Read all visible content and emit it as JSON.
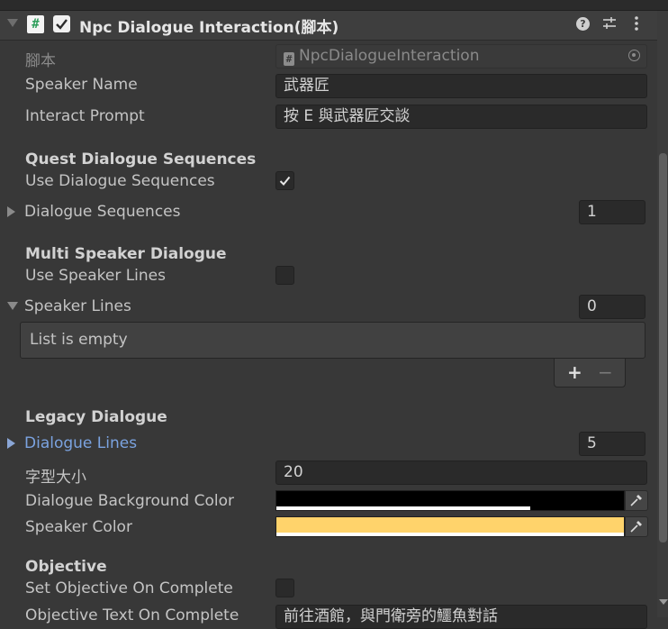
{
  "header": {
    "title": "Npc Dialogue Interaction(腳本)",
    "script_icon_glyph": "#",
    "help_glyph": "?",
    "enabled": true
  },
  "fields": {
    "script": {
      "label": "腳本",
      "value": "NpcDialogueInteraction",
      "icon_glyph": "#"
    },
    "speaker_name": {
      "label": "Speaker Name",
      "value": "武器匠"
    },
    "interact_prompt": {
      "label": "Interact Prompt",
      "value": "按 E 與武器匠交談"
    }
  },
  "quest_section": {
    "header": "Quest Dialogue Sequences",
    "use_label": "Use Dialogue Sequences",
    "use_checked": true,
    "list_label": "Dialogue Sequences",
    "list_count": "1"
  },
  "multi_section": {
    "header": "Multi Speaker Dialogue",
    "use_label": "Use Speaker Lines",
    "use_checked": false,
    "list_label": "Speaker Lines",
    "list_count": "0",
    "empty_text": "List is empty",
    "add_glyph": "+",
    "remove_glyph": "−"
  },
  "legacy_section": {
    "header": "Legacy Dialogue",
    "lines_label": "Dialogue Lines",
    "lines_count": "5",
    "font_size_label": "字型大小",
    "font_size_value": "20",
    "bg_color_label": "Dialogue Background Color",
    "bg_color": "#000000",
    "bg_alpha": 0.73,
    "speaker_color_label": "Speaker Color",
    "speaker_color": "#ffd36b",
    "speaker_alpha": 1.0
  },
  "objective_section": {
    "header": "Objective",
    "set_label": "Set Objective On Complete",
    "set_checked": false,
    "text_label": "Objective Text On Complete",
    "text_value": "前往酒館，與門衛旁的鱷魚對話"
  },
  "colors": {
    "panel_bg": "#383838",
    "link": "#7ba3e0",
    "check_green": "#2e9e5b"
  },
  "icons": [
    "fold-arrow-icon",
    "script-icon",
    "checkbox-icon",
    "help-icon",
    "presets-icon",
    "kebab-menu-icon",
    "object-picker-icon",
    "eyedropper-icon",
    "checkmark-icon"
  ]
}
